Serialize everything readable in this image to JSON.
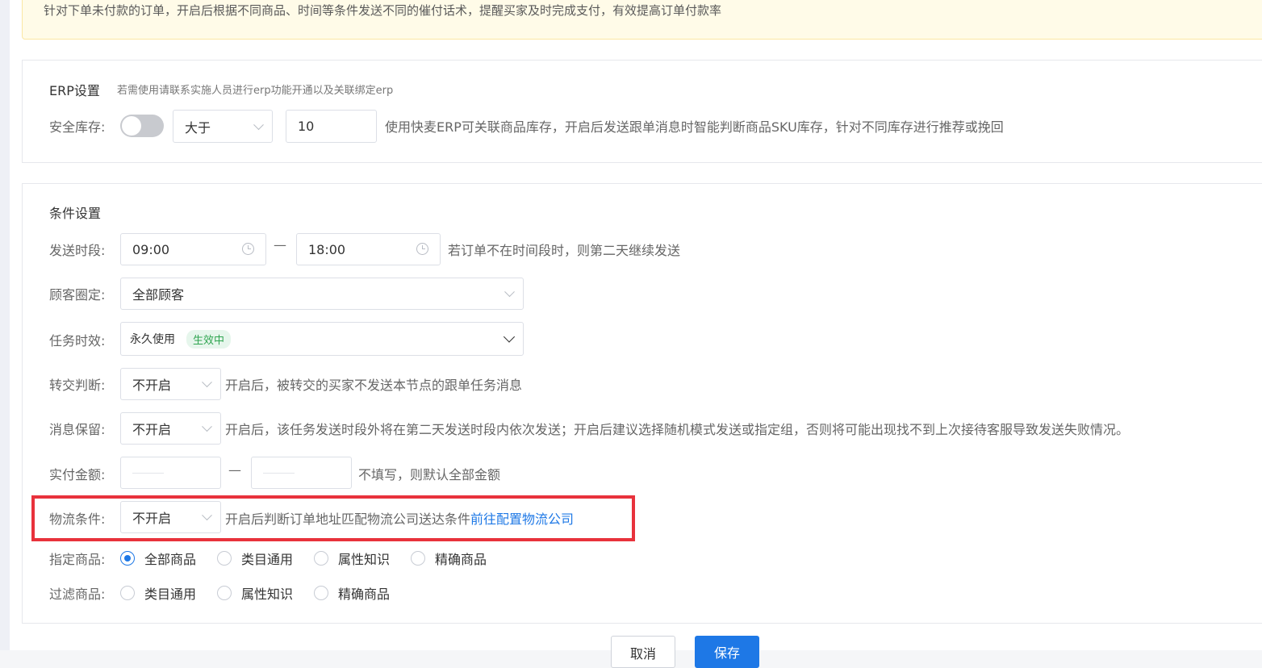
{
  "banner": {
    "text": "针对下单未付款的订单，开启后根据不同商品、时间等条件发送不同的催付话术，提醒买家及时完成支付，有效提高订单付款率"
  },
  "erp": {
    "title": "ERP设置",
    "subtitle": "若需使用请联系实施人员进行erp功能开通以及关联绑定erp",
    "stock_label": "安全库存:",
    "toggle_on": false,
    "compare_value": "大于",
    "stock_value": "10",
    "stock_hint": "使用快麦ERP可关联商品库存，开启后发送跟单消息时智能判断商品SKU库存，针对不同库存进行推荐或挽回"
  },
  "conditions": {
    "title": "条件设置",
    "send_time": {
      "label": "发送时段:",
      "start": "09:00",
      "separator": "—",
      "end": "18:00",
      "hint": "若订单不在时间段时，则第二天继续发送"
    },
    "customer": {
      "label": "顾客圈定:",
      "value": "全部顾客"
    },
    "validity": {
      "label": "任务时效:",
      "value": "永久使用",
      "badge": "生效中"
    },
    "transfer": {
      "label": "转交判断:",
      "value": "不开启",
      "hint": "开启后，被转交的买家不发送本节点的跟单任务消息"
    },
    "retain": {
      "label": "消息保留:",
      "value": "不开启",
      "hint": "开启后，该任务发送时段外将在第二天发送时段内依次发送；开启后建议选择随机模式发送或指定组，否则将可能出现找不到上次接待客服导致发送失败情况。"
    },
    "amount": {
      "label": "实付金额:",
      "separator": "—",
      "hint": "不填写，则默认全部金额"
    },
    "logistics": {
      "label": "物流条件:",
      "value": "不开启",
      "hint": "开启后判断订单地址匹配物流公司送达条件",
      "link": "前往配置物流公司"
    },
    "products": {
      "label": "指定商品:",
      "options": [
        "全部商品",
        "类目通用",
        "属性知识",
        "精确商品"
      ],
      "selected": "全部商品"
    },
    "filter": {
      "label": "过滤商品:",
      "options": [
        "类目通用",
        "属性知识",
        "精确商品"
      ]
    }
  },
  "footer": {
    "cancel": "取消",
    "save": "保存"
  }
}
